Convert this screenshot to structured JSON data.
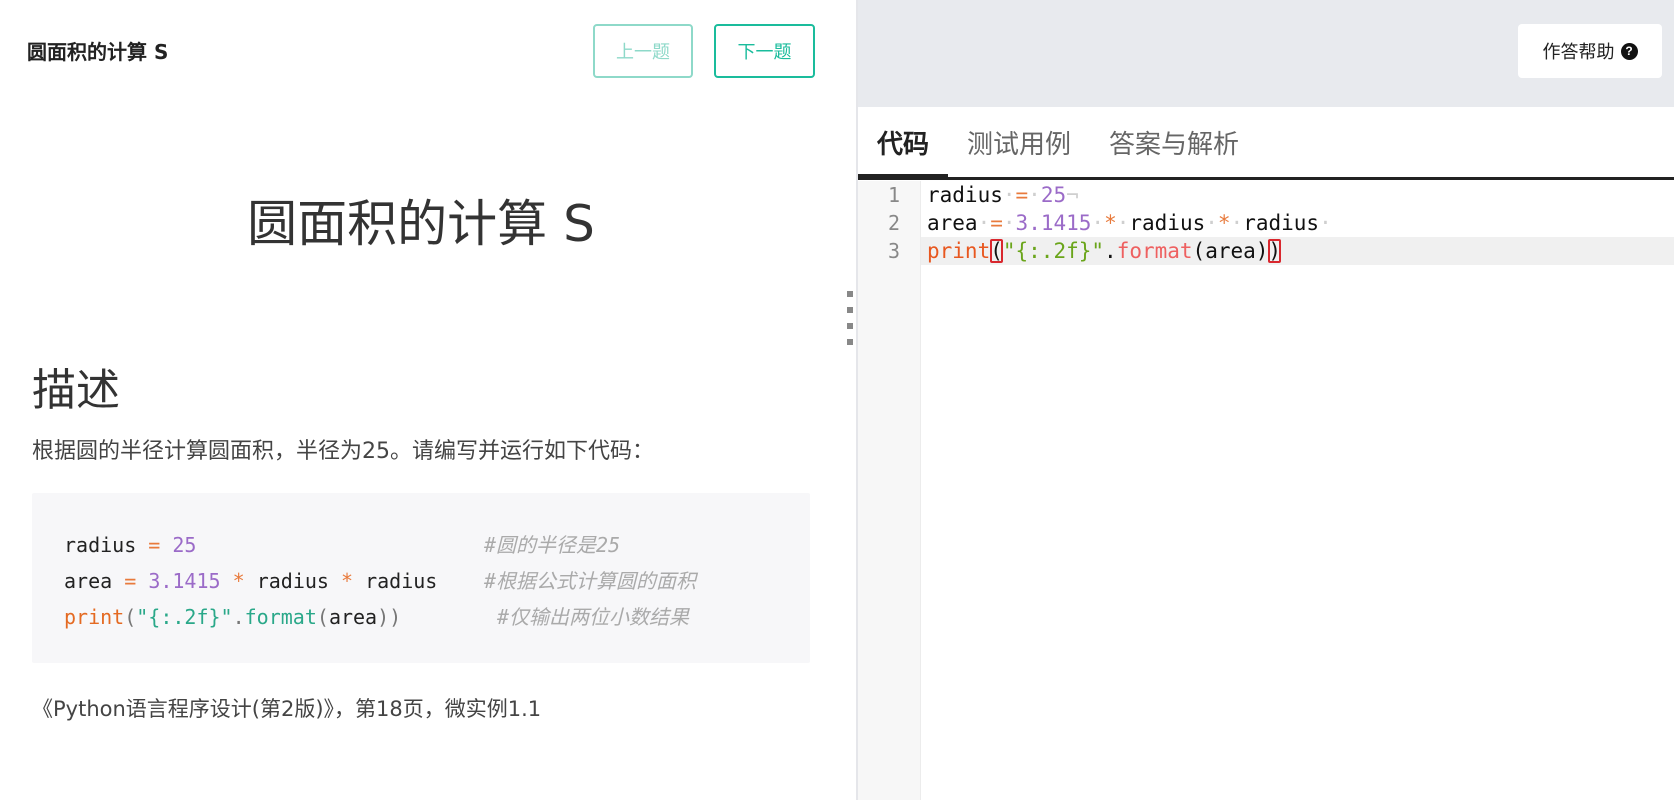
{
  "left": {
    "header_title": "圆面积的计算 S",
    "prev_label": "上一题",
    "next_label": "下一题",
    "problem_title": "圆面积的计算 S",
    "desc_heading": "描述",
    "desc_text": "根据圆的半径计算圆面积，半径为25。请编写并运行如下代码：",
    "code": [
      {
        "tokens": [
          [
            "var",
            "radius"
          ],
          [
            "sp",
            " "
          ],
          [
            "op",
            "="
          ],
          [
            "sp",
            " "
          ],
          [
            "num",
            "25"
          ]
        ],
        "comment": "#圆的半径是25"
      },
      {
        "tokens": [
          [
            "var",
            "area"
          ],
          [
            "sp",
            " "
          ],
          [
            "op",
            "="
          ],
          [
            "sp",
            " "
          ],
          [
            "num",
            "3.1415"
          ],
          [
            "sp",
            " "
          ],
          [
            "op",
            "*"
          ],
          [
            "sp",
            " "
          ],
          [
            "var",
            "radius"
          ],
          [
            "sp",
            " "
          ],
          [
            "op",
            "*"
          ],
          [
            "sp",
            " "
          ],
          [
            "var",
            "radius"
          ]
        ],
        "comment": "#根据公式计算圆的面积"
      },
      {
        "tokens": [
          [
            "kw",
            "print"
          ],
          [
            "paren",
            "("
          ],
          [
            "str",
            "\"{:.2f}\""
          ],
          [
            "paren",
            "."
          ],
          [
            "fn",
            "format"
          ],
          [
            "paren",
            "("
          ],
          [
            "var",
            "area"
          ],
          [
            "paren",
            "))"
          ]
        ],
        "comment": "#仅输出两位小数结果"
      }
    ],
    "source_text": "《Python语言程序设计(第2版)》，第18页，微实例1.1"
  },
  "right": {
    "help_label": "作答帮助",
    "help_icon": "question-circle-icon",
    "tabs": [
      "代码",
      "测试用例",
      "答案与解析"
    ],
    "active_tab": 0,
    "editor_lines": [
      {
        "num": "1",
        "tokens": [
          [
            "t",
            "radius"
          ],
          [
            "ws",
            "·"
          ],
          [
            "op",
            "="
          ],
          [
            "ws",
            "·"
          ],
          [
            "num",
            "25"
          ],
          [
            "ws",
            "¬"
          ]
        ]
      },
      {
        "num": "2",
        "tokens": [
          [
            "t",
            "area"
          ],
          [
            "ws",
            "·"
          ],
          [
            "op",
            "="
          ],
          [
            "ws",
            "·"
          ],
          [
            "num",
            "3.1415"
          ],
          [
            "ws",
            "·"
          ],
          [
            "op",
            "*"
          ],
          [
            "ws",
            "·"
          ],
          [
            "t",
            "radius"
          ],
          [
            "ws",
            "·"
          ],
          [
            "op",
            "*"
          ],
          [
            "ws",
            "·"
          ],
          [
            "t",
            "radius"
          ],
          [
            "ws",
            "·"
          ]
        ]
      },
      {
        "num": "3",
        "tokens": [
          [
            "kw",
            "print"
          ],
          [
            "br",
            "("
          ],
          [
            "str",
            "\"{:.2f}\""
          ],
          [
            "t",
            "."
          ],
          [
            "fn",
            "format"
          ],
          [
            "t",
            "(area)"
          ],
          [
            "br",
            ")"
          ]
        ]
      }
    ],
    "active_line": 2
  }
}
